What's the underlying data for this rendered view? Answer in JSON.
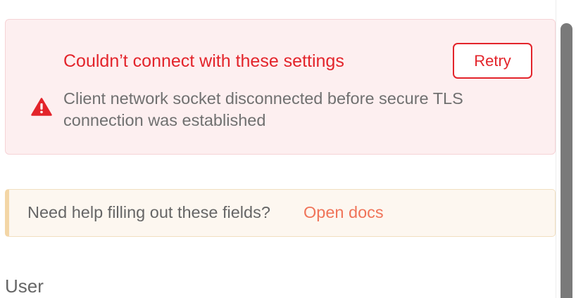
{
  "error_banner": {
    "icon": "warning-triangle-icon",
    "title": "Couldn’t connect with these settings",
    "message": "Client network socket disconnected before secure TLS connection was established",
    "retry_label": "Retry",
    "accent_color": "#e3242b"
  },
  "help_banner": {
    "text": "Need help filling out these fields?",
    "link_label": "Open docs",
    "link_color": "#f07459"
  },
  "form": {
    "field_label": "User"
  }
}
